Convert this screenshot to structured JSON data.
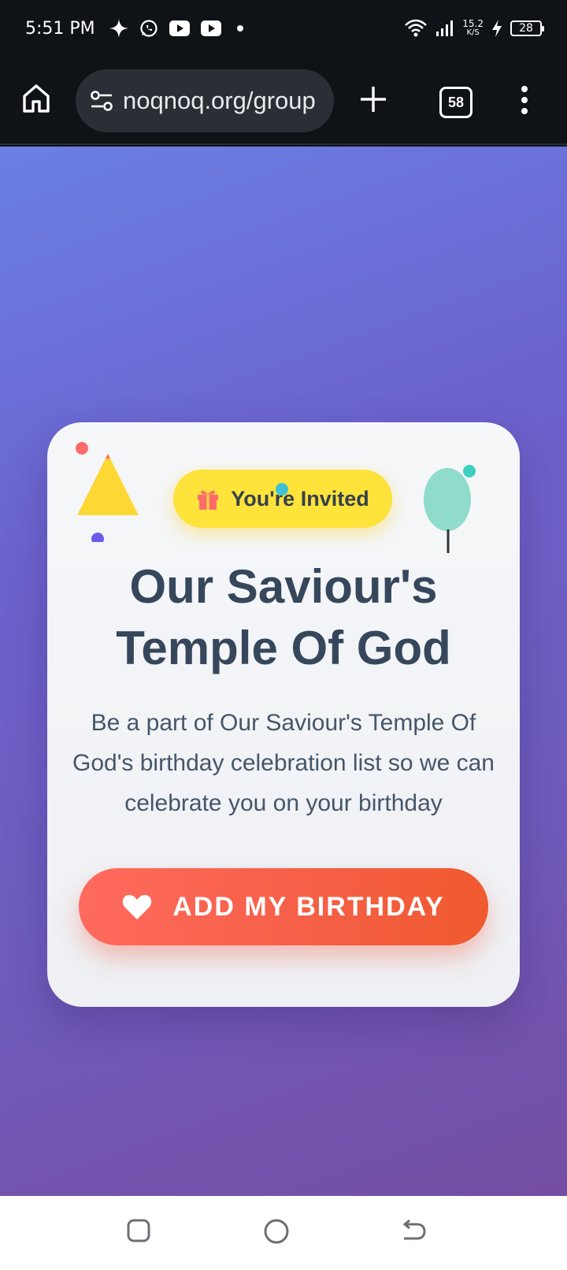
{
  "status_bar": {
    "time": "5:51 PM",
    "net_speed_value": "15.2",
    "net_speed_unit": "K/S",
    "battery": "28",
    "icons": [
      "sparkle-icon",
      "whatsapp-icon",
      "youtube-icon",
      "youtube-icon",
      "dot-icon",
      "wifi-icon",
      "signal-icon",
      "charging-icon",
      "battery-icon"
    ]
  },
  "browser": {
    "url": "noqnoq.org/group",
    "tab_count": "58",
    "icons": [
      "home-icon",
      "tune-icon",
      "plus-icon",
      "tabs-icon",
      "more-vert-icon"
    ]
  },
  "card": {
    "badge_label": "You're Invited",
    "title_line1": "Our Saviour's",
    "title_line2": "Temple Of God",
    "description": "Be a part of Our Saviour's Temple Of God's birthday celebration list so we can celebrate you on your birthday",
    "cta_label": "ADD MY BIRTHDAY"
  },
  "colors": {
    "badge": "#fde33a",
    "cta_start": "#ff6a5e",
    "cta_end": "#ef5a2e",
    "title": "#36475c",
    "bg_top": "#6a7fe4",
    "bg_bottom": "#754ea3"
  },
  "nav_bar": {
    "icons": [
      "recents-icon",
      "home-circle-icon",
      "back-icon"
    ]
  }
}
